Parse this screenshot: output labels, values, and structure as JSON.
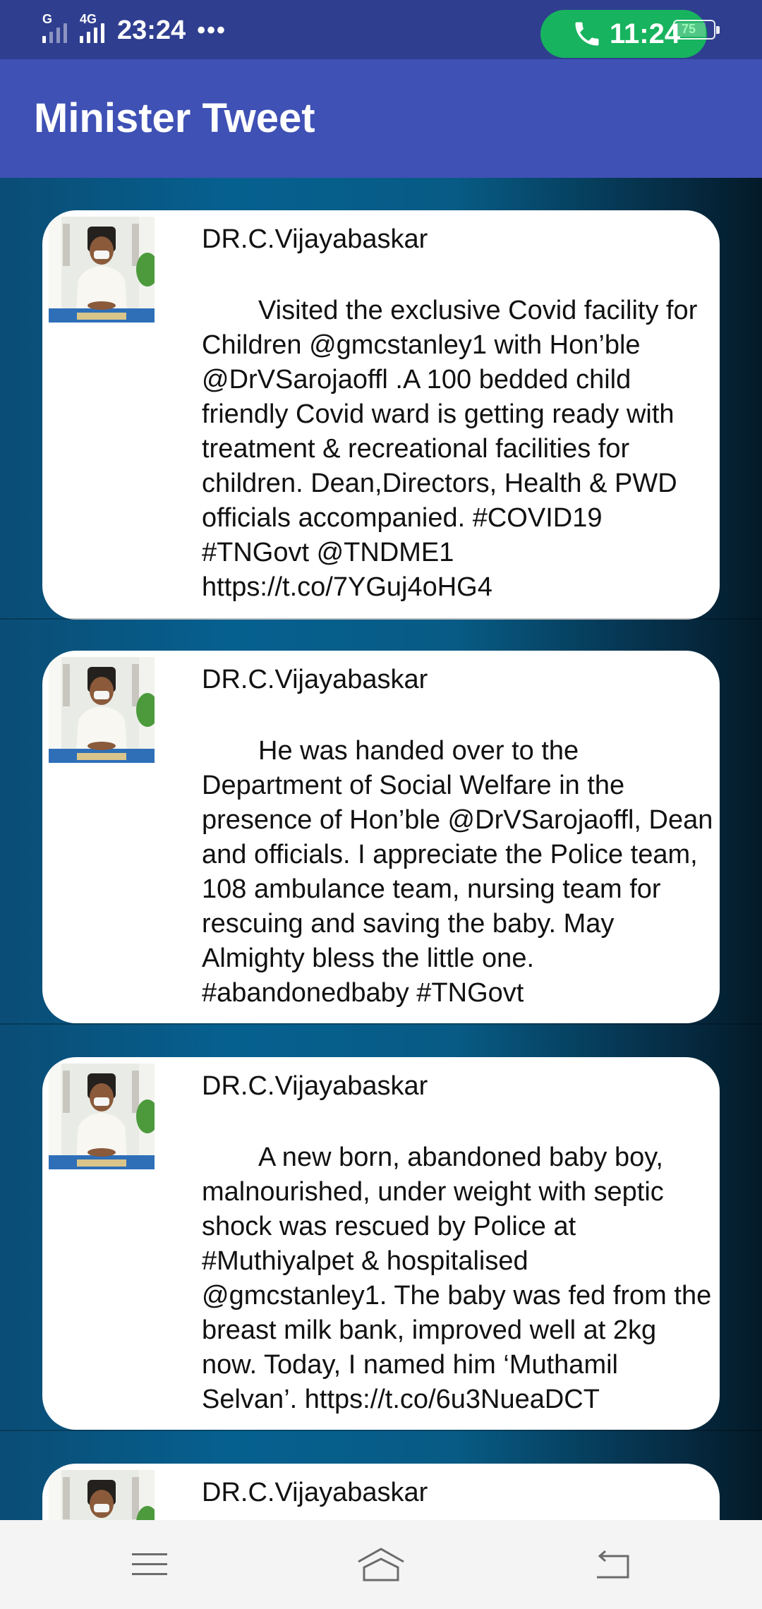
{
  "status_bar": {
    "network_1": "G",
    "network_2": "4G",
    "time": "23:24",
    "dots": "•••",
    "call_time": "11:24",
    "battery": "75"
  },
  "app_bar": {
    "title": "Minister Tweet"
  },
  "feed": {
    "tweets": [
      {
        "author": "DR.C.Vijayabaskar",
        "text": "Visited the exclusive Covid facility for Children @gmcstanley1 with Hon’ble @DrVSarojaoffl .A 100 bedded child friendly Covid ward is getting ready with treatment & recreational facilities for children. Dean,Directors, Health & PWD officials accompanied. #COVID19 #TNGovt @TNDME1 https://t.co/7YGuj4oHG4"
      },
      {
        "author": "DR.C.Vijayabaskar",
        "text": "He was handed over to the Department of Social Welfare in the presence of Hon’ble @DrVSarojaoffl, Dean and officials. I appreciate the Police team, 108 ambulance team, nursing team for rescuing and saving the baby. May Almighty bless the little one. #abandonedbaby #TNGovt"
      },
      {
        "author": "DR.C.Vijayabaskar",
        "text": "A new born, abandoned baby boy, malnourished, under weight with septic shock was rescued by Police at #Muthiyalpet & hospitalised @gmcstanley1. The baby was fed from the breast milk bank, improved well at 2kg now. Today, I named him ‘Muthamil Selvan’. https://t.co/6u3NueaDCT"
      },
      {
        "author": "DR.C.Vijayabaskar",
        "text": ""
      }
    ]
  },
  "colors": {
    "status_bar": "#2f3e8f",
    "app_bar": "#3f51b5",
    "call_pill": "#17b35e",
    "nav_bar": "#f4f4f4"
  },
  "icons": {
    "call": "phone-icon",
    "menu": "menu-icon",
    "home": "home-icon",
    "back": "back-icon"
  }
}
